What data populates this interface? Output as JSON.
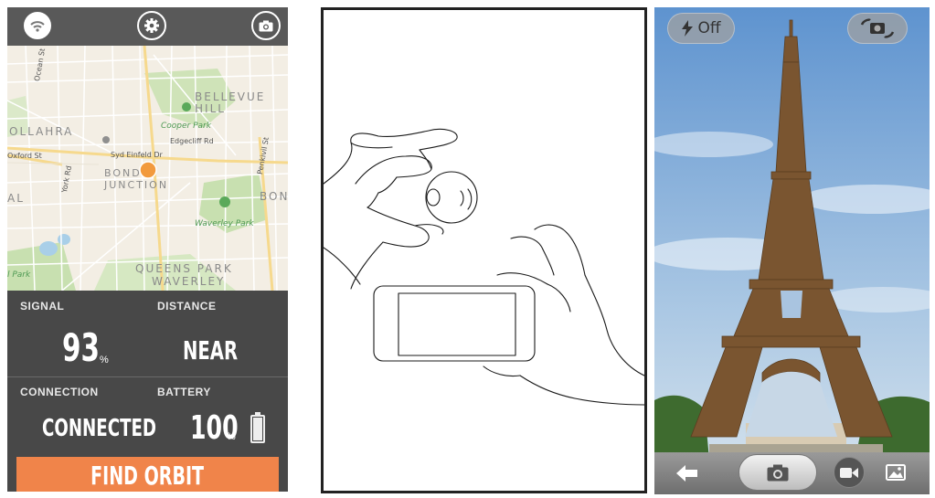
{
  "app": {
    "top_icons": [
      "signal-icon",
      "gear-icon",
      "camera-icon"
    ],
    "map": {
      "labels": {
        "bellevue_hill": "BELLEVUE\nHILL",
        "ollahra": "OLLAHRA",
        "cooper_park": "Cooper Park",
        "edgecliff_rd": "Edgecliff Rd",
        "syd_einfeld_dr": "Syd Einfeld Dr",
        "oxford_st": "Oxford St",
        "ocean_st": "Ocean St",
        "bond_junction": "BOND\nJUNCTION",
        "york_rd": "York Rd",
        "penkivil_st": "Penkivil St",
        "bon": "BON",
        "al": "AL",
        "waverley_park": "Waverley Park",
        "queens_park": "QUEENS PARK",
        "waverley": "WAVERLEY",
        "park": "l Park"
      }
    },
    "stats": {
      "signal_label": "SIGNAL",
      "signal_value": "93",
      "signal_unit": "%",
      "distance_label": "DISTANCE",
      "distance_value": "NEAR",
      "connection_label": "CONNECTION",
      "connection_value": "CONNECTED",
      "battery_label": "BATTERY",
      "battery_value": "100",
      "battery_unit": "%",
      "battery_level": 1.0
    },
    "find_button": "FIND ORBIT",
    "colors": {
      "accent": "#f0844a",
      "panel": "#484848",
      "map_marker": "#f29a3d"
    }
  },
  "camera": {
    "flash_label": "Off",
    "icons": [
      "flash-icon",
      "switch-camera-icon",
      "back-arrow-icon",
      "shutter-camera-icon",
      "video-icon",
      "gallery-icon"
    ]
  }
}
